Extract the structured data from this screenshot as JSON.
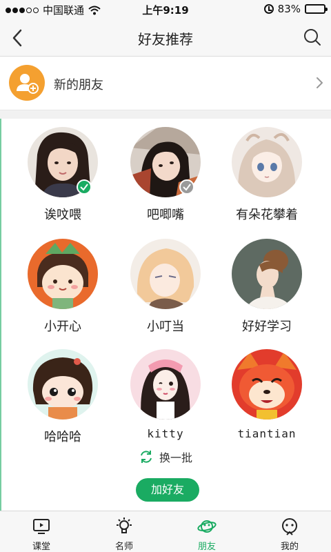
{
  "status_bar": {
    "carrier": "中国联通",
    "time": "上午9:19",
    "battery": "83%",
    "battery_level": 0.83
  },
  "nav": {
    "title": "好友推荐"
  },
  "new_friends": {
    "label": "新的朋友"
  },
  "friends": [
    {
      "name": "诶呅喂",
      "status": "green"
    },
    {
      "name": "吧唧嘴",
      "status": "gray"
    },
    {
      "name": "有朵花攀着",
      "status": ""
    },
    {
      "name": "小开心",
      "status": ""
    },
    {
      "name": "小叮当",
      "status": ""
    },
    {
      "name": "好好学习",
      "status": ""
    },
    {
      "name": "哈哈哈",
      "status": ""
    },
    {
      "name": "kitty",
      "status": ""
    },
    {
      "name": "tiantian",
      "status": ""
    }
  ],
  "refresh": {
    "label": "换一批"
  },
  "add_friend": {
    "label": "加好友"
  },
  "tabs": [
    {
      "label": "课堂",
      "icon": "tv-icon"
    },
    {
      "label": "名师",
      "icon": "lightbulb-icon"
    },
    {
      "label": "朋友",
      "icon": "planet-icon",
      "active": true
    },
    {
      "label": "我的",
      "icon": "face-icon"
    }
  ],
  "colors": {
    "accent": "#1aab62",
    "new_friend_avatar": "#f4a030"
  }
}
